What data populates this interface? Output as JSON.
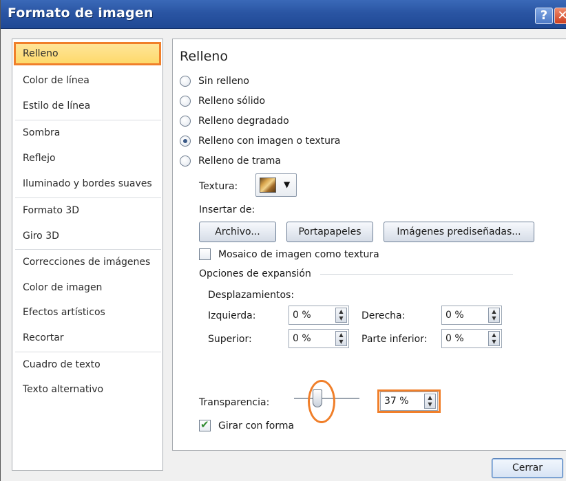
{
  "window": {
    "title": "Formato de imagen",
    "help_glyph": "?",
    "close_glyph": "✕"
  },
  "nav": {
    "items": [
      {
        "label": "Relleno",
        "selected": true
      },
      {
        "label": "Color de línea"
      },
      {
        "label": "Estilo de línea"
      },
      {
        "label": "Sombra"
      },
      {
        "label": "Reflejo"
      },
      {
        "label": "Iluminado y bordes suaves"
      },
      {
        "label": "Formato 3D"
      },
      {
        "label": "Giro 3D"
      },
      {
        "label": "Correcciones de imágenes"
      },
      {
        "label": "Color de imagen"
      },
      {
        "label": "Efectos artísticos"
      },
      {
        "label": "Recortar"
      },
      {
        "label": "Cuadro de texto"
      },
      {
        "label": "Texto alternativo"
      }
    ]
  },
  "panel": {
    "title": "Relleno",
    "fill_options": [
      {
        "label": "Sin relleno",
        "checked": false
      },
      {
        "label": "Relleno sólido",
        "checked": false
      },
      {
        "label": "Relleno degradado",
        "checked": false
      },
      {
        "label": "Relleno con imagen o textura",
        "checked": true
      },
      {
        "label": "Relleno de trama",
        "checked": false
      }
    ],
    "texture_label": "Textura:",
    "texture_icon": "texture-swatch-icon",
    "insert_from_label": "Insertar de:",
    "buttons": {
      "file": "Archivo...",
      "clipboard": "Portapapeles",
      "clipart": "Imágenes prediseñadas..."
    },
    "tile_checkbox": {
      "label": "Mosaico de imagen como textura",
      "checked": false
    },
    "stretch_options_label": "Opciones de expansión",
    "offsets_label": "Desplazamientos:",
    "offsets": {
      "left": {
        "label": "Izquierda:",
        "value": "0 %"
      },
      "right": {
        "label": "Derecha:",
        "value": "0 %"
      },
      "top": {
        "label": "Superior:",
        "value": "0 %"
      },
      "bottom": {
        "label": "Parte inferior:",
        "value": "0 %"
      }
    },
    "transparency": {
      "label": "Transparencia:",
      "value": "37 %",
      "level": 0.37
    },
    "rotate_checkbox": {
      "label": "Girar con forma",
      "checked": true
    }
  },
  "footer": {
    "close_label": "Cerrar"
  },
  "colors": {
    "titlebar": "#2a55a3",
    "highlight_orange": "#f07f2a",
    "selected_fill": "#fdd96b"
  }
}
